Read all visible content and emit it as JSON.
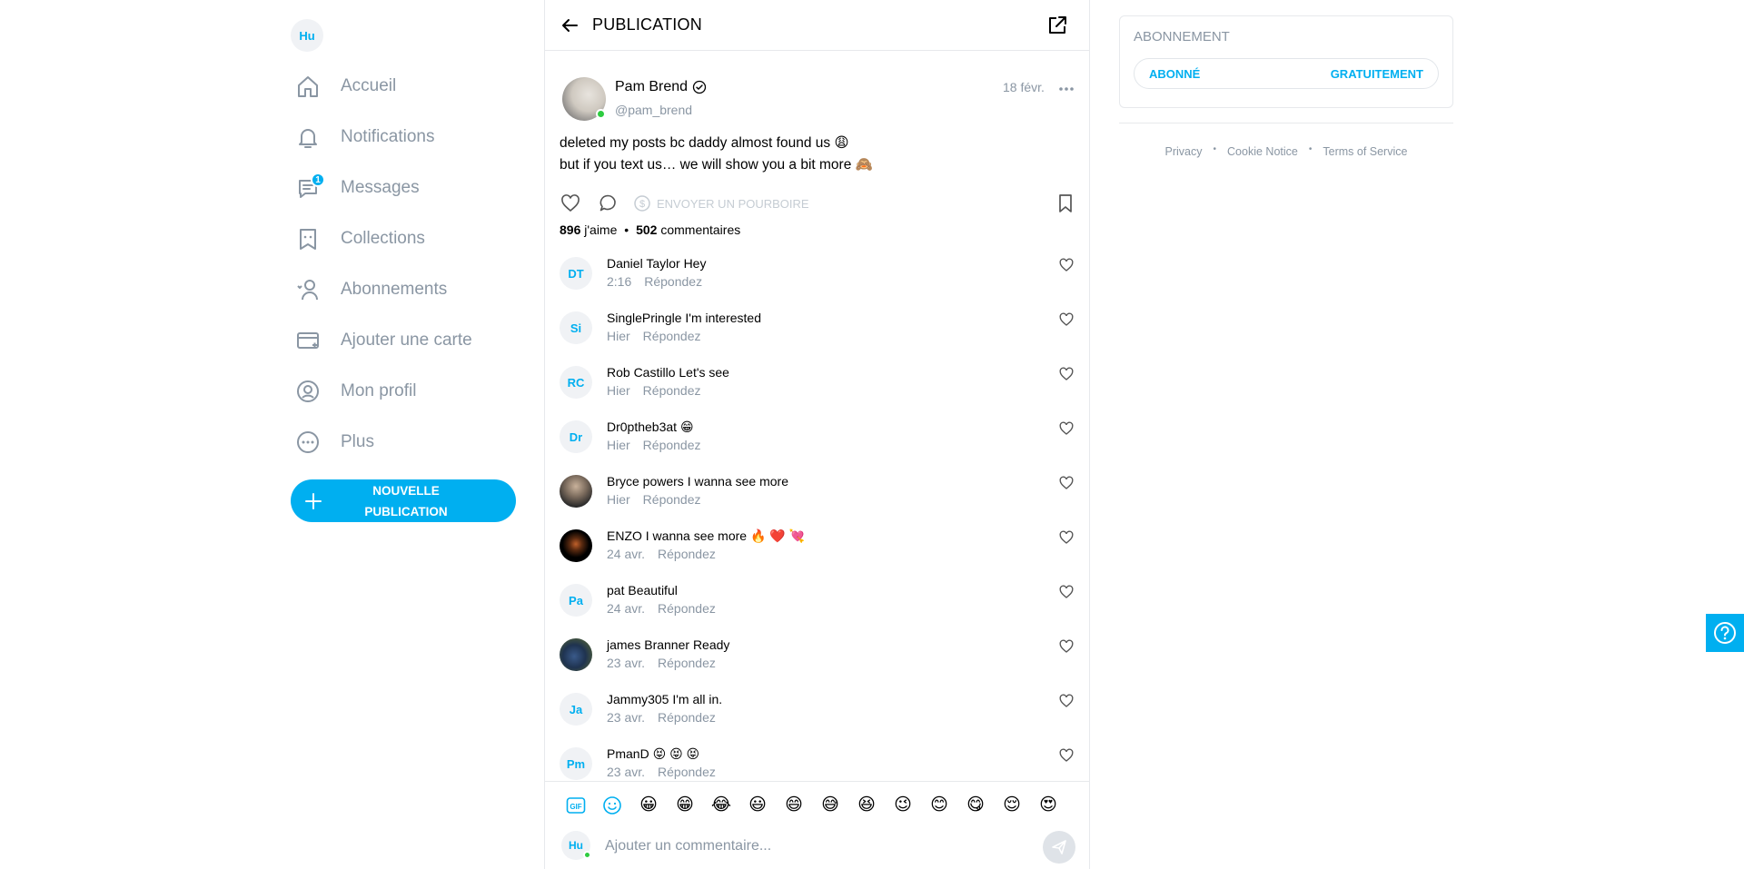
{
  "colors": {
    "accent": "#00aff0",
    "muted": "#8a96a3",
    "online": "#2ecc40"
  },
  "user": {
    "initials": "Hu"
  },
  "sidebar": {
    "items": [
      {
        "label": "Accueil",
        "icon": "home-icon"
      },
      {
        "label": "Notifications",
        "icon": "bell-icon"
      },
      {
        "label": "Messages",
        "icon": "message-icon",
        "badge": "1"
      },
      {
        "label": "Collections",
        "icon": "collections-icon"
      },
      {
        "label": "Abonnements",
        "icon": "subscriptions-icon"
      },
      {
        "label": "Ajouter une carte",
        "icon": "card-icon"
      },
      {
        "label": "Mon profil",
        "icon": "profile-icon"
      },
      {
        "label": "Plus",
        "icon": "more-icon"
      }
    ],
    "new_post_line1": "NOUVELLE",
    "new_post_line2": "PUBLICATION"
  },
  "header": {
    "title": "PUBLICATION"
  },
  "post": {
    "author": "Pam Brend",
    "handle": "@pam_brend",
    "date": "18 févr.",
    "text_line1": "deleted my posts bc daddy almost found us 😩",
    "text_line2": "but if you text us… we will show you a bit more 🙈",
    "tip_label": "ENVOYER UN POURBOIRE",
    "likes_count": "896",
    "likes_label": "j'aime",
    "stats_sep": "•",
    "comments_count": "502",
    "comments_label": "commentaires"
  },
  "comments": [
    {
      "initials": "DT",
      "user": "Daniel Taylor",
      "text": "Hey",
      "time": "2:16",
      "reply": "Répondez"
    },
    {
      "initials": "Si",
      "user": "SinglePringle",
      "text": "I'm interested",
      "time": "Hier",
      "reply": "Répondez"
    },
    {
      "initials": "RC",
      "user": "Rob Castillo",
      "text": "Let's see",
      "time": "Hier",
      "reply": "Répondez"
    },
    {
      "initials": "Dr",
      "user": "Dr0ptheb3at",
      "text": "😁",
      "time": "Hier",
      "reply": "Répondez"
    },
    {
      "initials": "",
      "user": "Bryce powers",
      "text": "I wanna see more",
      "time": "Hier",
      "reply": "Répondez",
      "photo": "photo-a"
    },
    {
      "initials": "",
      "user": "ENZO",
      "text": "I wanna see more 🔥 ❤️ 💘",
      "time": "24 avr.",
      "reply": "Répondez",
      "photo": "photo-b"
    },
    {
      "initials": "Pa",
      "user": "pat",
      "text": "Beautiful",
      "time": "24 avr.",
      "reply": "Répondez"
    },
    {
      "initials": "",
      "user": "james Branner",
      "text": "Ready",
      "time": "23 avr.",
      "reply": "Répondez",
      "photo": "photo-c"
    },
    {
      "initials": "Ja",
      "user": "Jammy305",
      "text": "I'm all in.",
      "time": "23 avr.",
      "reply": "Répondez"
    },
    {
      "initials": "Pm",
      "user": "PmanD",
      "text": "😝 😝 😝",
      "time": "23 avr.",
      "reply": "Répondez"
    }
  ],
  "emoji_bar": [
    "😀",
    "😁",
    "😂",
    "😃",
    "😄",
    "😅",
    "😆",
    "😉",
    "😊",
    "😋",
    "😌",
    "😍"
  ],
  "comment_box": {
    "initials": "Hu",
    "placeholder": "Ajouter un commentaire..."
  },
  "right": {
    "subscription_title": "ABONNEMENT",
    "subscribed_label": "ABONNÉ",
    "free_label": "GRATUITEMENT",
    "footer": [
      "Privacy",
      "Cookie Notice",
      "Terms of Service"
    ],
    "footer_sep": "•"
  }
}
